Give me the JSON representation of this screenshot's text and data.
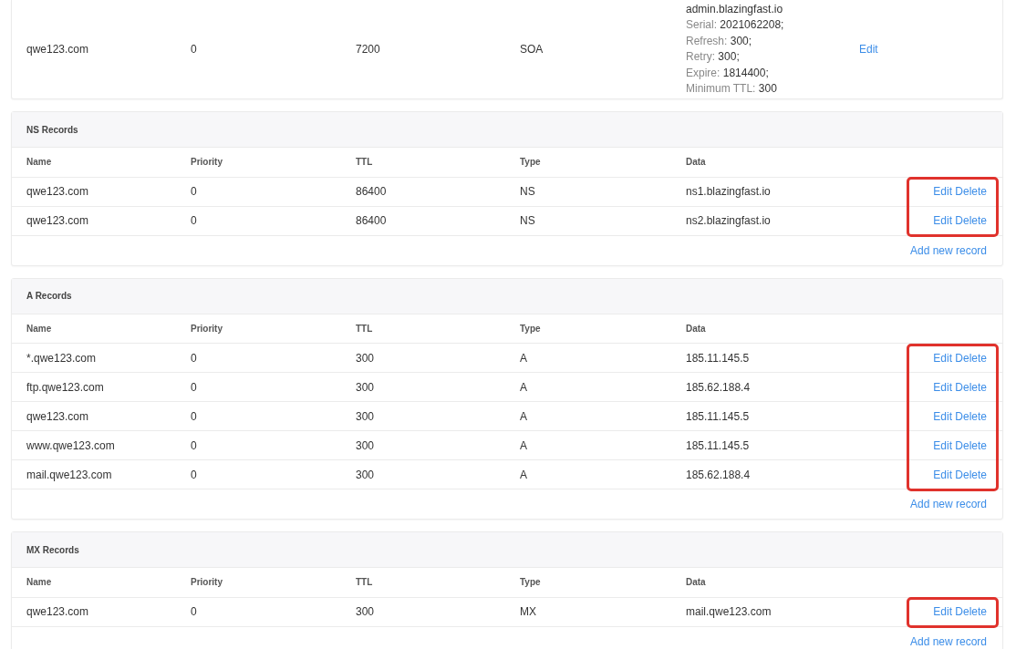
{
  "soa_record": {
    "name": "qwe123.com",
    "priority": "0",
    "ttl": "7200",
    "type": "SOA",
    "action": "Edit",
    "data_lines": [
      {
        "value": "admin.blazingfast.io"
      },
      {
        "label": "Serial:",
        "value": "2021062208;"
      },
      {
        "label": "Refresh:",
        "value": "300;"
      },
      {
        "label": "Retry:",
        "value": "300;"
      },
      {
        "label": "Expire:",
        "value": "1814400;"
      },
      {
        "label": "Minimum TTL:",
        "value": "300"
      }
    ]
  },
  "sections": [
    {
      "title": "NS Records",
      "columns": [
        "Name",
        "Priority",
        "TTL",
        "Type",
        "Data"
      ],
      "highlighted": true,
      "add_link": "Add new record",
      "rows": [
        {
          "name": "qwe123.com",
          "priority": "0",
          "ttl": "86400",
          "type": "NS",
          "data": "ns1.blazingfast.io",
          "actions": [
            "Edit",
            "Delete"
          ]
        },
        {
          "name": "qwe123.com",
          "priority": "0",
          "ttl": "86400",
          "type": "NS",
          "data": "ns2.blazingfast.io",
          "actions": [
            "Edit",
            "Delete"
          ]
        }
      ]
    },
    {
      "title": "A Records",
      "columns": [
        "Name",
        "Priority",
        "TTL",
        "Type",
        "Data"
      ],
      "highlighted": true,
      "add_link": "Add new record",
      "rows": [
        {
          "name": "*.qwe123.com",
          "priority": "0",
          "ttl": "300",
          "type": "A",
          "data": "185.11.145.5",
          "actions": [
            "Edit",
            "Delete"
          ]
        },
        {
          "name": "ftp.qwe123.com",
          "priority": "0",
          "ttl": "300",
          "type": "A",
          "data": "185.62.188.4",
          "actions": [
            "Edit",
            "Delete"
          ]
        },
        {
          "name": "qwe123.com",
          "priority": "0",
          "ttl": "300",
          "type": "A",
          "data": "185.11.145.5",
          "actions": [
            "Edit",
            "Delete"
          ]
        },
        {
          "name": "www.qwe123.com",
          "priority": "0",
          "ttl": "300",
          "type": "A",
          "data": "185.11.145.5",
          "actions": [
            "Edit",
            "Delete"
          ]
        },
        {
          "name": "mail.qwe123.com",
          "priority": "0",
          "ttl": "300",
          "type": "A",
          "data": "185.62.188.4",
          "actions": [
            "Edit",
            "Delete"
          ]
        }
      ]
    },
    {
      "title": "MX Records",
      "columns": [
        "Name",
        "Priority",
        "TTL",
        "Type",
        "Data"
      ],
      "highlighted": true,
      "add_link": "Add new record",
      "rows": [
        {
          "name": "qwe123.com",
          "priority": "0",
          "ttl": "300",
          "type": "MX",
          "data": "mail.qwe123.com",
          "actions": [
            "Edit",
            "Delete"
          ]
        }
      ]
    }
  ]
}
